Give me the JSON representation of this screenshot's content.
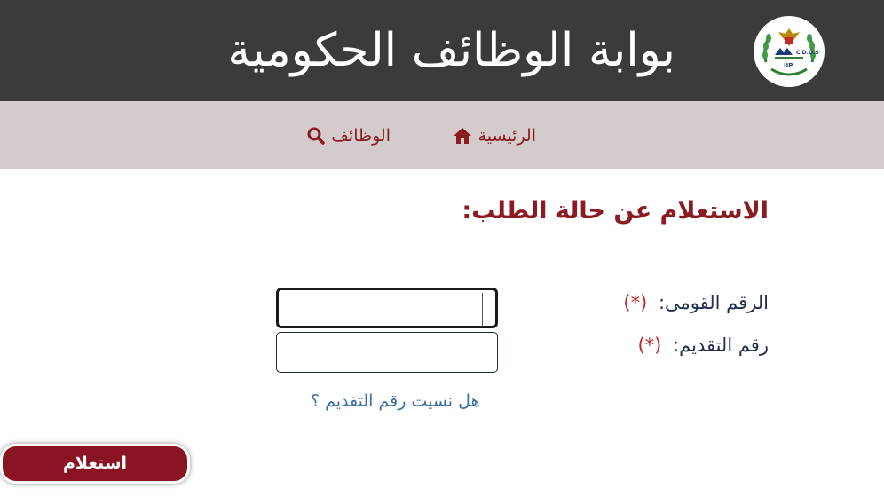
{
  "header": {
    "title": "بوابة الوظائف الحكومية",
    "logo": {
      "icon": "egypt-eagle-emblem",
      "text_top": "C.D.O.S",
      "text_bottom": "IIP",
      "accent": "#2e7d32",
      "brand": "#1f3a7a"
    }
  },
  "nav": {
    "items": [
      {
        "label": "الرئيسية",
        "icon": "home-icon"
      },
      {
        "label": "الوظائف",
        "icon": "search-icon"
      }
    ]
  },
  "main": {
    "heading": "الاستعلام عن حالة الطلب:",
    "fields": [
      {
        "label": "الرقم القومى:",
        "required_mark": "(*)",
        "value": ""
      },
      {
        "label": "رقم التقديم:",
        "required_mark": "(*)",
        "value": ""
      }
    ],
    "forgot_link": "هل نسيت رقم التقديم ؟",
    "submit_label": "استعلام"
  },
  "colors": {
    "header_bg": "#3b3b3b",
    "nav_bg": "#d4cccc",
    "accent": "#8b1a22",
    "button_bg": "#8b1422",
    "label": "#1f2f4d",
    "required": "#c1272d",
    "link": "#3a6ea5"
  }
}
